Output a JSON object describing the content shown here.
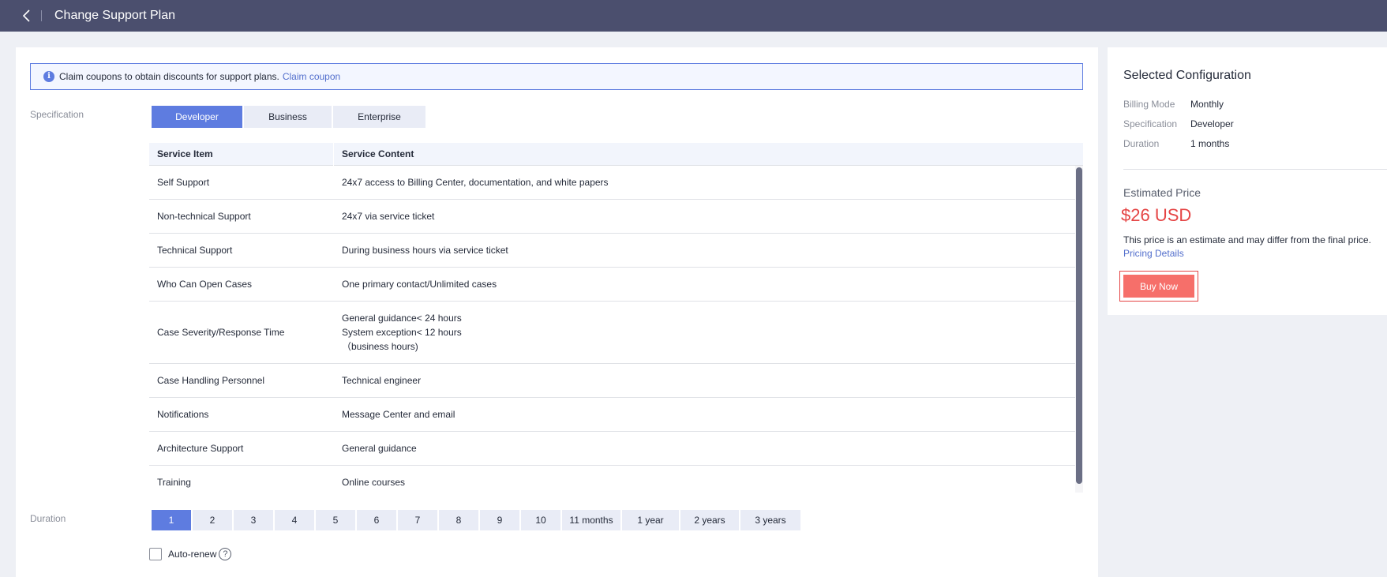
{
  "header": {
    "title": "Change Support Plan"
  },
  "notice": {
    "text": "Claim coupons to obtain discounts for support plans.",
    "link": "Claim coupon"
  },
  "specification": {
    "label": "Specification",
    "tabs": [
      "Developer",
      "Business",
      "Enterprise"
    ],
    "selected": "Developer"
  },
  "table": {
    "headers": [
      "Service Item",
      "Service Content"
    ],
    "rows": [
      {
        "item": "Self Support",
        "content": "24x7 access to Billing Center, documentation, and white papers"
      },
      {
        "item": "Non-technical Support",
        "content": "24x7 via service ticket"
      },
      {
        "item": "Technical Support",
        "content": "During business hours via service ticket"
      },
      {
        "item": "Who Can Open Cases",
        "content": "One primary contact/Unlimited cases"
      },
      {
        "item": "Case Severity/Response Time",
        "content_lines": [
          "General guidance< 24 hours",
          "System exception< 12 hours",
          "（business hours)"
        ]
      },
      {
        "item": "Case Handling Personnel",
        "content": "Technical engineer"
      },
      {
        "item": "Notifications",
        "content": "Message Center and email"
      },
      {
        "item": "Architecture Support",
        "content": "General guidance"
      },
      {
        "item": "Training",
        "content": "Online courses"
      }
    ]
  },
  "duration": {
    "label": "Duration",
    "options": [
      "1",
      "2",
      "3",
      "4",
      "5",
      "6",
      "7",
      "8",
      "9",
      "10",
      "11 months",
      "1 year",
      "2 years",
      "3 years"
    ],
    "selected": "1"
  },
  "auto_renew": {
    "label": "Auto-renew",
    "help_icon": "?"
  },
  "summary": {
    "title": "Selected Configuration",
    "billing_mode_label": "Billing Mode",
    "billing_mode": "Monthly",
    "spec_label": "Specification",
    "spec": "Developer",
    "duration_label": "Duration",
    "duration": "1 months",
    "estimated_label": "Estimated Price",
    "price": "$26 USD",
    "note": "This price is an estimate and may differ from the final price.",
    "pricing_link": "Pricing Details",
    "buy_button": "Buy Now"
  },
  "colors": {
    "accent": "#5e7ce0",
    "header_bg": "#4b4f6e",
    "price": "#e54545",
    "buy": "#f66f6a"
  }
}
